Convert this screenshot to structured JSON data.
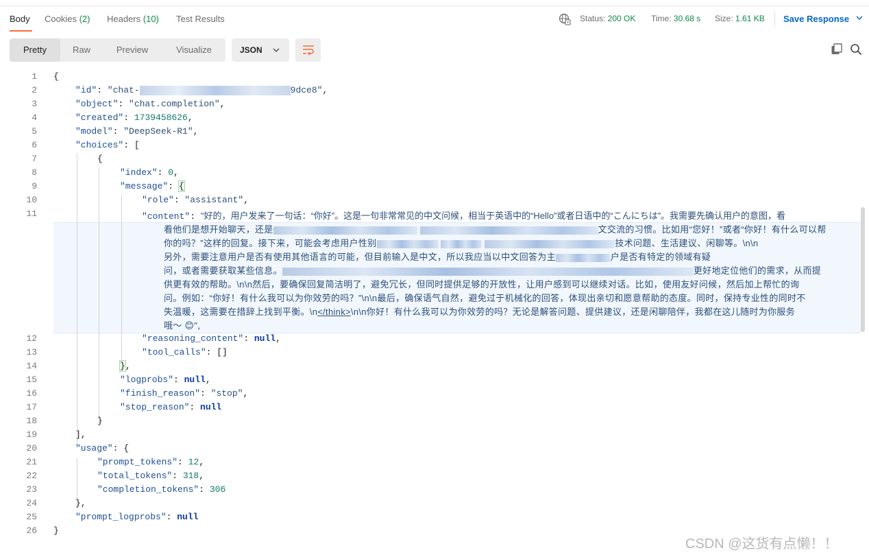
{
  "tabs": [
    {
      "label": "Body",
      "count": ""
    },
    {
      "label": "Cookies",
      "count": "(2)"
    },
    {
      "label": "Headers",
      "count": "(10)"
    },
    {
      "label": "Test Results",
      "count": ""
    }
  ],
  "status": {
    "label": "Status:",
    "value": "200 OK"
  },
  "time": {
    "label": "Time:",
    "value": "30.68 s"
  },
  "size": {
    "label": "Size:",
    "value": "1.61 KB"
  },
  "save_response": "Save Response",
  "view_modes": [
    "Pretty",
    "Raw",
    "Preview",
    "Visualize"
  ],
  "format": "JSON",
  "icons": {
    "globe": "network-icon",
    "wrap": "wrap-lines-icon",
    "copy": "copy-icon",
    "search": "search-icon"
  },
  "colors": {
    "accent": "#ff6c37",
    "link": "#0265d2",
    "success": "#0f8a48"
  },
  "line_numbers": [
    "1",
    "2",
    "3",
    "4",
    "5",
    "6",
    "7",
    "8",
    "9",
    "10",
    "11",
    "12",
    "13",
    "14",
    "15",
    "16",
    "17",
    "18",
    "19",
    "20",
    "21",
    "22",
    "23",
    "24",
    "25",
    "26"
  ],
  "json": {
    "id_start": "\"chat-",
    "id_end": "9dce8\"",
    "object": "\"chat.completion\"",
    "created": "1739458626",
    "model": "\"DeepSeek-R1\"",
    "index": "0",
    "role": "\"assistant\"",
    "content_lines": [
      "\"好的，用户发来了一句话：“你好”。这是一句非常常见的中文问候，相当于英语中的“Hello”或者日语中的“こんにちは”。我需要先确认用户的意图，看",
      "看他们是想开始聊天，还是",
      "文交流的习惯。比如用“您好！”或者“你好！有什么可以帮",
      "你的吗？”这样的回复。接下来，可能会考虑用户性别",
      "技术问题、生活建议、闲聊等。\\n\\n",
      "另外，需要注意用户是否有使用其他语言的可能，但目前输入是中文，所以我应当以中文回答为主",
      "户是否有特定的领域有疑",
      "问，或者需要获取某些信息。",
      "更好地定位他们的需求，从而提",
      "供更有效的帮助。\\n\\n然后，要确保回复简洁明了，避免冗长，但同时提供足够的开放性，让用户感到可以继续对话。比如，使用友好问候，然后加上帮忙的询",
      "问。例如：“你好！有什么我可以为你效劳的吗？”\\n\\n最后，确保语气自然，避免过于机械化的回答，体现出亲切和愿意帮助的态度。同时，保持专业性的同时不",
      "失温暖，这需要在措辞上找到平衡。\\n",
      "</think>",
      "\\n\\n你好！有什么我可以为你效劳的吗？无论是解答问题、提供建议，还是闲聊陪伴，我都在这儿随时为你服务",
      "哦～ 😊\""
    ],
    "reasoning_content": "null",
    "tool_calls": "[]",
    "logprobs": "null",
    "finish_reason": "\"stop\"",
    "stop_reason": "null",
    "prompt_tokens": "12",
    "total_tokens": "318",
    "completion_tokens": "306",
    "prompt_logprobs": "null"
  },
  "watermark": "CSDN @这货有点懒！！"
}
